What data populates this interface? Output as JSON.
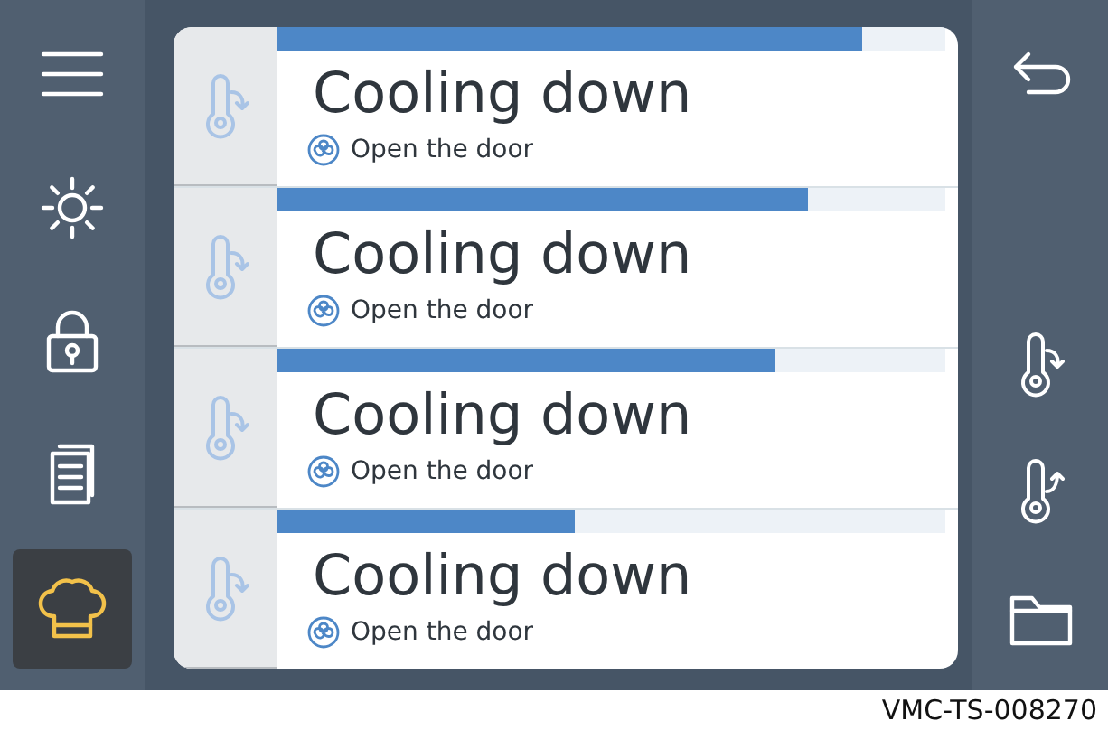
{
  "left_nav": [
    {
      "kind": "menu",
      "selected": false
    },
    {
      "kind": "brightness",
      "selected": false
    },
    {
      "kind": "lock",
      "selected": false
    },
    {
      "kind": "document",
      "selected": false
    },
    {
      "kind": "chef",
      "selected": true
    }
  ],
  "rows": [
    {
      "title": "Cooling down",
      "hint": "Open the door",
      "level": 0.876
    },
    {
      "title": "Cooling down",
      "hint": "Open the door",
      "level": 0.795
    },
    {
      "title": "Cooling down",
      "hint": "Open the door",
      "level": 0.746
    },
    {
      "title": "Cooling down",
      "hint": "Open the door",
      "level": 0.446
    }
  ],
  "footer_code": "VMC-TS-008270"
}
